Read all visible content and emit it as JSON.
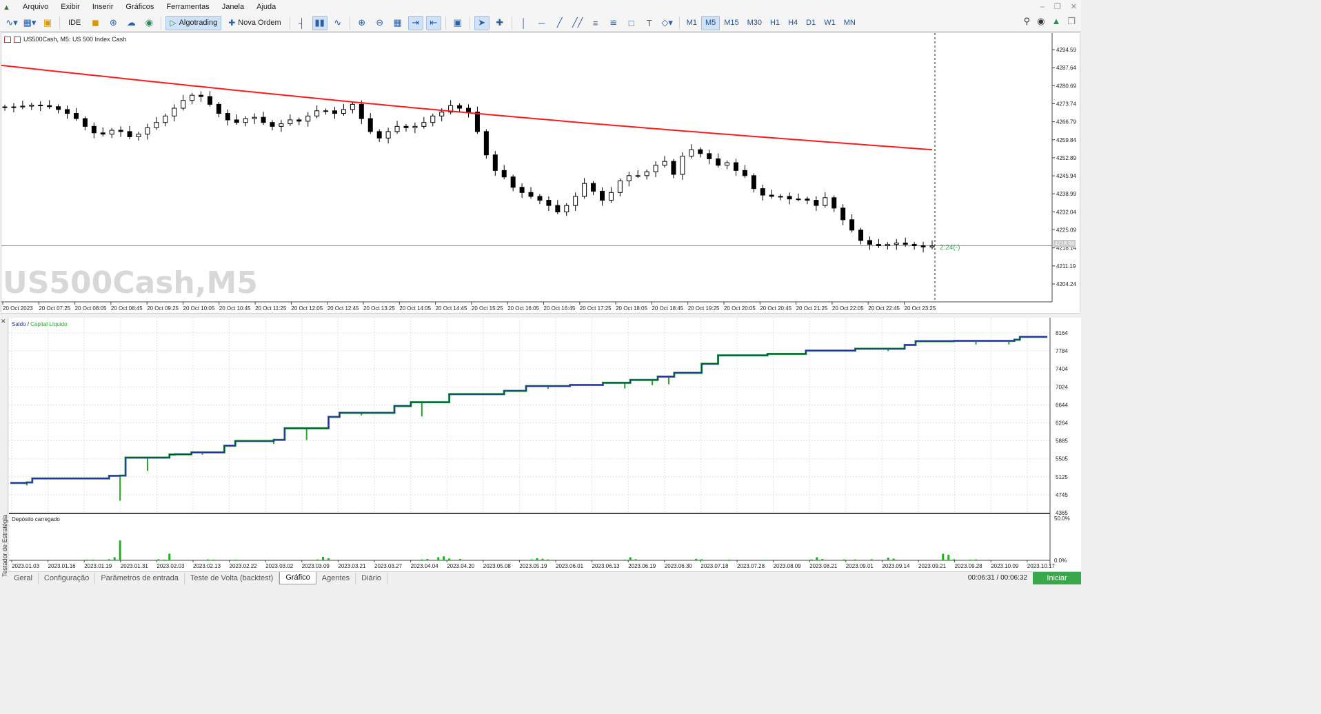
{
  "menu": [
    "Arquivo",
    "Exibir",
    "Inserir",
    "Gráficos",
    "Ferramentas",
    "Janela",
    "Ajuda"
  ],
  "toolbar": {
    "ide_label": "IDE",
    "algotrading_label": "Algotrading",
    "new_order_label": "Nova Ordem",
    "timeframes": [
      "M1",
      "M5",
      "M15",
      "M30",
      "H1",
      "H4",
      "D1",
      "W1",
      "MN"
    ],
    "active_timeframe": "M5"
  },
  "chart": {
    "header": "US500Cash, M5:  US 500 Index Cash",
    "watermark": "US500Cash,M5",
    "timer": "2:24(-)",
    "current_price_badge": "4218.98"
  },
  "tester": {
    "side_label": "Testador de Estratégia",
    "legend_balance": "Saldo",
    "legend_sep": " / ",
    "legend_equity": "Capital Líquido",
    "deposit_label": "Depósito carregado",
    "tabs": [
      "Geral",
      "Configuração",
      "Parâmetros de entrada",
      "Teste de Volta (backtest)",
      "Gráfico",
      "Agentes",
      "Diário"
    ],
    "active_tab": "Gráfico",
    "time_info": "00:06:31 / 00:06:32",
    "start_label": "Iniciar"
  },
  "chart_data": [
    {
      "type": "candlestick",
      "title": "US500Cash, M5:  US 500 Index Cash",
      "ylim": [
        4200,
        4300
      ],
      "y_ticks": [
        "4294.59",
        "4287.64",
        "4280.69",
        "4273.74",
        "4266.79",
        "4259.84",
        "4252.89",
        "4245.94",
        "4238.99",
        "4232.04",
        "4225.09",
        "4218.14",
        "4211.19",
        "4204.24"
      ],
      "x_ticks": [
        "20 Oct 2023",
        "20 Oct 07:25",
        "20 Oct 08:05",
        "20 Oct 08:45",
        "20 Oct 09:25",
        "20 Oct 10:05",
        "20 Oct 10:45",
        "20 Oct 11:25",
        "20 Oct 12:05",
        "20 Oct 12:45",
        "20 Oct 13:25",
        "20 Oct 14:05",
        "20 Oct 14:45",
        "20 Oct 15:25",
        "20 Oct 16:05",
        "20 Oct 16:45",
        "20 Oct 17:25",
        "20 Oct 18:05",
        "20 Oct 18:45",
        "20 Oct 19:25",
        "20 Oct 20:05",
        "20 Oct 20:45",
        "20 Oct 21:25",
        "20 Oct 22:05",
        "20 Oct 22:45",
        "20 Oct 23:25"
      ],
      "close_path": [
        4272.5,
        4272.5,
        4272.8,
        4273.2,
        4273.0,
        4272.6,
        4271.5,
        4270.0,
        4268.0,
        4265.0,
        4262.5,
        4262.0,
        4263.5,
        4263.0,
        4261.0,
        4262.0,
        4264.5,
        4266.5,
        4269.0,
        4272.0,
        4275.0,
        4277.0,
        4276.5,
        4273.5,
        4270.0,
        4267.5,
        4266.5,
        4268.0,
        4268.5,
        4266.5,
        4265.0,
        4266.0,
        4267.5,
        4267.0,
        4269.0,
        4271.0,
        4271.0,
        4270.0,
        4271.5,
        4273.5,
        4268.0,
        4263.0,
        4260.5,
        4263.0,
        4265.0,
        4264.5,
        4265.0,
        4266.5,
        4269.0,
        4270.5,
        4273.0,
        4272.0,
        4270.5,
        4263.0,
        4254.0,
        4248.0,
        4245.5,
        4241.5,
        4239.5,
        4238.0,
        4236.5,
        4234.5,
        4232.0,
        4234.5,
        4238.0,
        4243.0,
        4240.0,
        4236.5,
        4239.5,
        4244.0,
        4246.0,
        4246.0,
        4247.5,
        4250.0,
        4251.5,
        4246.5,
        4253.5,
        4256.0,
        4254.5,
        4252.5,
        4250.0,
        4251.0,
        4248.0,
        4246.0,
        4241.0,
        4238.5,
        4238.0,
        4238.0,
        4237.0,
        4237.0,
        4236.5,
        4234.5,
        4237.5,
        4233.5,
        4229.0,
        4225.0,
        4221.0,
        4219.5,
        4219.0,
        4219.5,
        4220.0,
        4219.5,
        4219.0,
        4218.5,
        4218.9
      ],
      "ma_series": {
        "color": "#ff1a1a",
        "start": 4288.5,
        "end": 4256.0
      }
    },
    {
      "type": "line",
      "series": [
        {
          "name": "Saldo",
          "color": "#1e2fa8"
        },
        {
          "name": "Capital Líquido",
          "color": "#22a722"
        }
      ],
      "ylim": [
        4365,
        8300
      ],
      "y_ticks": [
        "8164",
        "7784",
        "7404",
        "7024",
        "6644",
        "6264",
        "5885",
        "5505",
        "5125",
        "4745",
        "4365"
      ],
      "x_ticks": [
        "2023.01.03",
        "2023.01.16",
        "2023.01.19",
        "2023.01.31",
        "2023.02.03",
        "2023.02.13",
        "2023.02.22",
        "2023.03.02",
        "2023.03.09",
        "2023.03.21",
        "2023.03.27",
        "2023.04.04",
        "2023.04.20",
        "2023.05.08",
        "2023.05.19",
        "2023.06.01",
        "2023.06.13",
        "2023.06.19",
        "2023.06.30",
        "2023.07.18",
        "2023.07.28",
        "2023.08.09",
        "2023.08.21",
        "2023.09.01",
        "2023.09.14",
        "2023.09.21",
        "2023.09.28",
        "2023.10.09",
        "2023.10.17"
      ],
      "balance_points": [
        [
          0,
          4995
        ],
        [
          3,
          5005
        ],
        [
          4,
          5090
        ],
        [
          18,
          5145
        ],
        [
          19,
          5145
        ],
        [
          20,
          5150
        ],
        [
          21,
          5530
        ],
        [
          29,
          5595
        ],
        [
          30,
          5600
        ],
        [
          33,
          5640
        ],
        [
          39,
          5780
        ],
        [
          41,
          5880
        ],
        [
          48,
          5905
        ],
        [
          50,
          6150
        ],
        [
          58,
          6390
        ],
        [
          60,
          6475
        ],
        [
          70,
          6620
        ],
        [
          73,
          6700
        ],
        [
          80,
          6870
        ],
        [
          90,
          6940
        ],
        [
          94,
          7040
        ],
        [
          102,
          7065
        ],
        [
          108,
          7110
        ],
        [
          113,
          7170
        ],
        [
          118,
          7240
        ],
        [
          121,
          7320
        ],
        [
          126,
          7510
        ],
        [
          129,
          7690
        ],
        [
          138,
          7720
        ],
        [
          145,
          7790
        ],
        [
          154,
          7830
        ],
        [
          163,
          7910
        ],
        [
          165,
          7990
        ],
        [
          172,
          7995
        ],
        [
          183,
          8020
        ],
        [
          184,
          8080
        ]
      ],
      "equity_dips": [
        [
          3,
          4940
        ],
        [
          20,
          4620
        ],
        [
          25,
          5250
        ],
        [
          35,
          5590
        ],
        [
          48,
          5820
        ],
        [
          54,
          5900
        ],
        [
          60,
          6380
        ],
        [
          64,
          6420
        ],
        [
          75,
          6400
        ],
        [
          88,
          6890
        ],
        [
          98,
          6980
        ],
        [
          112,
          6990
        ],
        [
          117,
          7060
        ],
        [
          120,
          7080
        ],
        [
          160,
          7780
        ],
        [
          176,
          7920
        ],
        [
          182,
          7920
        ]
      ],
      "deposit_label": "Depósito carregado",
      "deposit_ticks": [
        "50.0%",
        "0.0%"
      ],
      "deposit_bars": [
        [
          14,
          3
        ],
        [
          15,
          3
        ],
        [
          18,
          5
        ],
        [
          19,
          14
        ],
        [
          20,
          90
        ],
        [
          27,
          5
        ],
        [
          28,
          3
        ],
        [
          29,
          30
        ],
        [
          36,
          4
        ],
        [
          37,
          3
        ],
        [
          41,
          3
        ],
        [
          47,
          2
        ],
        [
          56,
          4
        ],
        [
          57,
          16
        ],
        [
          58,
          9
        ],
        [
          75,
          4
        ],
        [
          76,
          6
        ],
        [
          78,
          14
        ],
        [
          79,
          18
        ],
        [
          80,
          8
        ],
        [
          82,
          6
        ],
        [
          95,
          4
        ],
        [
          96,
          10
        ],
        [
          97,
          7
        ],
        [
          98,
          4
        ],
        [
          106,
          2
        ],
        [
          112,
          3
        ],
        [
          113,
          14
        ],
        [
          114,
          5
        ],
        [
          125,
          7
        ],
        [
          126,
          5
        ],
        [
          131,
          3
        ],
        [
          138,
          2
        ],
        [
          146,
          4
        ],
        [
          147,
          14
        ],
        [
          148,
          6
        ],
        [
          152,
          4
        ],
        [
          154,
          4
        ],
        [
          157,
          5
        ],
        [
          160,
          12
        ],
        [
          161,
          8
        ],
        [
          170,
          30
        ],
        [
          171,
          25
        ],
        [
          172,
          5
        ],
        [
          175,
          3
        ],
        [
          176,
          4
        ],
        [
          189,
          2
        ]
      ]
    }
  ]
}
